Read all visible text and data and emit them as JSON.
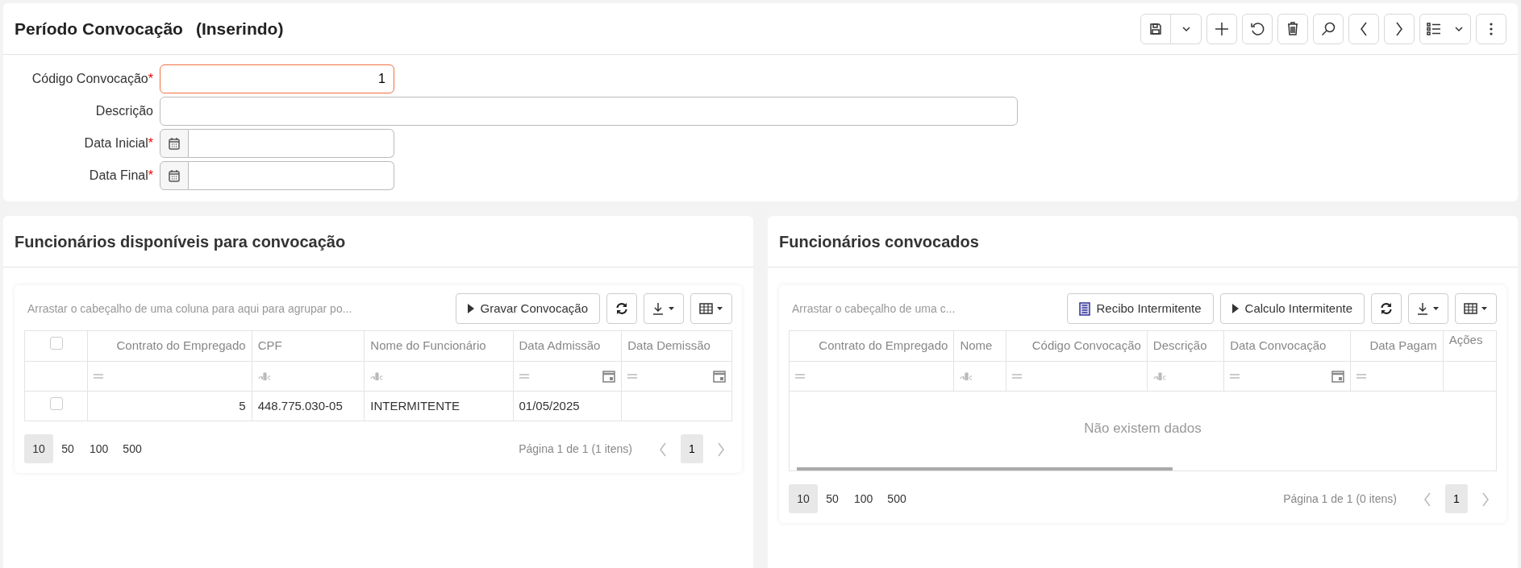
{
  "header": {
    "title": "Período Convocação",
    "mode": "(Inserindo)"
  },
  "form": {
    "fields": [
      {
        "label": "Código Convocação",
        "required_mark": "*",
        "kind": "number",
        "value": "1",
        "focused": true
      },
      {
        "label": "Descrição",
        "kind": "text",
        "focused": false
      },
      {
        "label": "Data Inicial",
        "required_mark": "*",
        "kind": "date",
        "focused": false
      },
      {
        "label": "Data Final",
        "required_mark": "*",
        "kind": "date",
        "focused": false
      }
    ]
  },
  "panels": [
    {
      "title": "Funcionários disponíveis para convocação",
      "group_hint": "Arrastar o cabeçalho de uma coluna para aqui para agrupar po...",
      "select_column": true,
      "header_checked": false,
      "actions": [
        {
          "kind": "play",
          "label": "Gravar Convocação"
        },
        {
          "kind": "refresh"
        },
        {
          "kind": "download"
        },
        {
          "kind": "columns"
        }
      ],
      "columns": [
        {
          "label": "Contrato do Empregado",
          "kind": "number"
        },
        {
          "label": "CPF",
          "kind": "text"
        },
        {
          "label": "Nome do Funcionário",
          "kind": "text"
        },
        {
          "label": "Data Admissão",
          "kind": "date"
        },
        {
          "label": "Data Demissão",
          "kind": "date"
        }
      ],
      "rows": [
        {
          "checked": false,
          "cells": [
            "5",
            "448.775.030-05",
            "INTERMITENTE",
            "01/05/2025"
          ]
        }
      ],
      "scrollbar": false,
      "page_sizes": [
        {
          "label": "10",
          "selected": true
        },
        {
          "label": "50",
          "selected": false
        },
        {
          "label": "100",
          "selected": false
        },
        {
          "label": "500",
          "selected": false
        }
      ],
      "pager_info": "Página 1 de 1 (1 itens)",
      "current_page": "1"
    },
    {
      "title": "Funcionários convocados",
      "group_hint": "Arrastar o cabeçalho de uma c...",
      "select_column": false,
      "actions": [
        {
          "kind": "receipt",
          "label": "Recibo Intermitente"
        },
        {
          "kind": "play",
          "label": "Calculo Intermitente"
        },
        {
          "kind": "refresh"
        },
        {
          "kind": "download"
        },
        {
          "kind": "columns"
        }
      ],
      "columns": [
        {
          "label": "Contrato do Empregado",
          "kind": "number"
        },
        {
          "label": "Nome",
          "kind": "text"
        },
        {
          "label": "Código Convocação",
          "kind": "number"
        },
        {
          "label": "Descrição",
          "kind": "text"
        },
        {
          "label": "Data Convocação",
          "kind": "date"
        },
        {
          "label": "Data Pagam",
          "kind": "number"
        },
        {
          "label": "Ações",
          "kind": "actions"
        }
      ],
      "empty_text": "Não existem dados",
      "scrollbar": true,
      "page_sizes": [
        {
          "label": "10",
          "selected": true
        },
        {
          "label": "50",
          "selected": false
        },
        {
          "label": "100",
          "selected": false
        },
        {
          "label": "500",
          "selected": false
        }
      ],
      "pager_info": "Página 1 de 1 (0 itens)",
      "current_page": "1"
    }
  ]
}
